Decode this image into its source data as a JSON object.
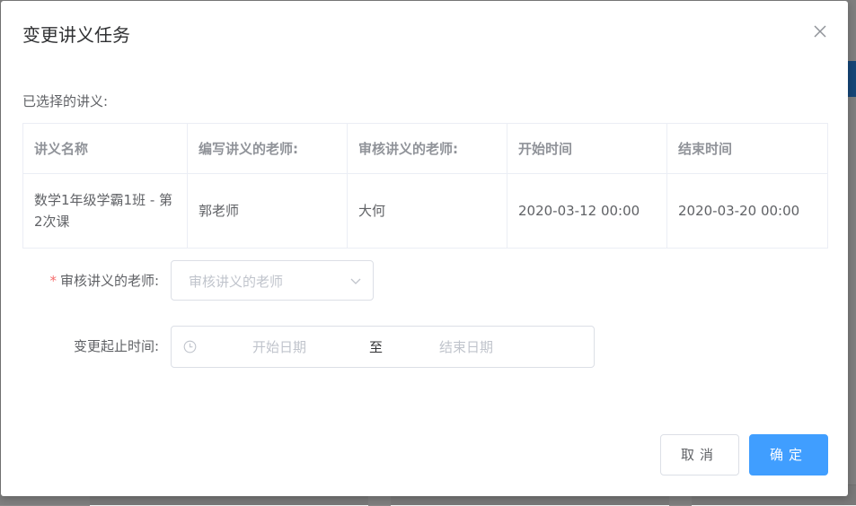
{
  "dialog": {
    "title": "变更讲义任务",
    "selected_label": "已选择的讲义:"
  },
  "table": {
    "headers": [
      "讲义名称",
      "编写讲义的老师:",
      "审核讲义的老师:",
      "开始时间",
      "结束时间"
    ],
    "rows": [
      [
        "数学1年级学霸1班 - 第2次课",
        "郭老师",
        "大何",
        "2020-03-12 00:00",
        "2020-03-20 00:00"
      ]
    ]
  },
  "form": {
    "reviewer_label": "审核讲义的老师:",
    "reviewer_required_mark": "*",
    "reviewer_placeholder": "审核讲义的老师",
    "period_label": "变更起止时间:",
    "start_placeholder": "开始日期",
    "range_separator": "至",
    "end_placeholder": "结束日期"
  },
  "buttons": {
    "cancel": "取消",
    "ok": "确定"
  },
  "colors": {
    "primary": "#409eff",
    "required": "#f56c6c",
    "overlay": "rgba(0,0,0,0.5)"
  },
  "icons": {
    "close": "close-icon",
    "dropdown": "chevron-down-icon",
    "clock": "clock-icon"
  }
}
